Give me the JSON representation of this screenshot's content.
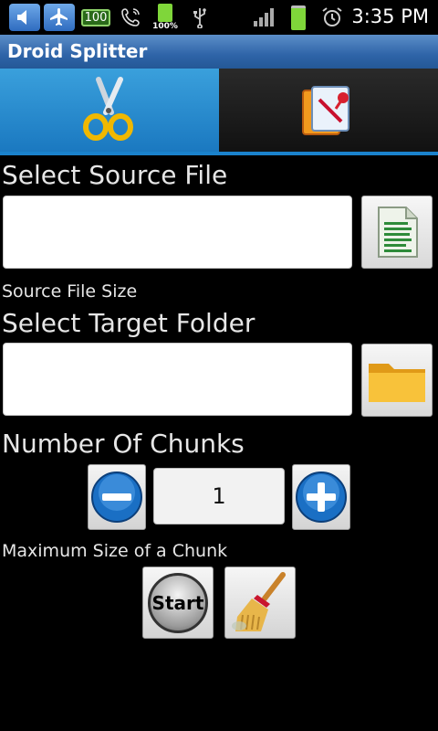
{
  "status_bar": {
    "time": "3:35 PM",
    "notification_badge": "100",
    "battery_percent": "100%",
    "icons": [
      "volume-icon",
      "airplane-icon",
      "notification-badge",
      "phone-icon",
      "battery-charging-icon",
      "usb-icon",
      "signal-icon",
      "battery-icon",
      "alarm-icon"
    ]
  },
  "app": {
    "title": "Droid Splitter"
  },
  "tabs": [
    {
      "icon": "scissors-icon",
      "selected": true
    },
    {
      "icon": "merge-document-icon",
      "selected": false
    }
  ],
  "source": {
    "label": "Select Source File",
    "value": "",
    "browse_icon": "spreadsheet-file-icon",
    "size_label": "Source File Size"
  },
  "target": {
    "label": "Select Target Folder",
    "value": "",
    "browse_icon": "folder-icon"
  },
  "chunks": {
    "label": "Number Of Chunks",
    "value": "1",
    "decrement_icon": "minus-icon",
    "increment_icon": "plus-icon",
    "max_size_label": "Maximum Size of a Chunk"
  },
  "actions": {
    "start_label": "Start",
    "clear_icon": "broom-icon"
  },
  "colors": {
    "title_bar": "#2e64a8",
    "selected_tab": "#1a82cc",
    "background": "#000000"
  }
}
